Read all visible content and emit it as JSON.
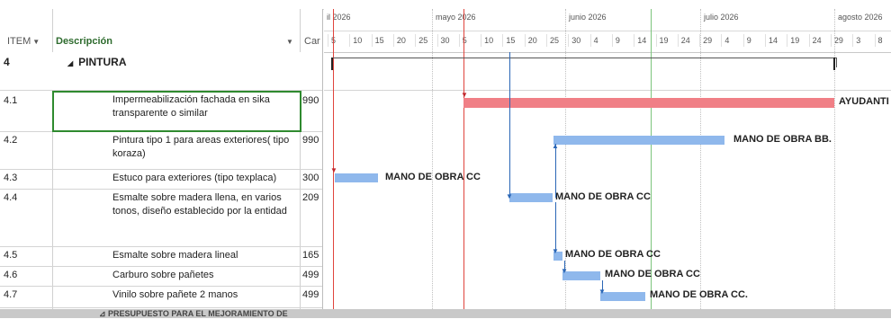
{
  "header": {
    "col_item": "ITEM",
    "col_desc": "Descripción",
    "col_car": "Car"
  },
  "timescale": {
    "months": [
      "il 2026",
      "mayo 2026",
      "junio 2026",
      "julio 2026",
      "agosto 2026"
    ],
    "days": [
      "5",
      "10",
      "15",
      "20",
      "25",
      "30",
      "5",
      "10",
      "15",
      "20",
      "25",
      "30",
      "4",
      "9",
      "14",
      "19",
      "24",
      "29",
      "4",
      "9",
      "14",
      "19",
      "24",
      "29",
      "3",
      "8"
    ]
  },
  "rows": [
    {
      "id": "4",
      "desc": "PINTURA",
      "car": "",
      "summary": true,
      "collapse_glyph": "◢"
    },
    {
      "id": "4.1",
      "desc": "Impermeabilización fachada en sika transparente o similar",
      "car": "990"
    },
    {
      "id": "4.2",
      "desc": "Pintura tipo 1 para areas exteriores( tipo koraza)",
      "car": "990"
    },
    {
      "id": "4.3",
      "desc": "Estuco para exteriores (tipo texplaca)",
      "car": "300"
    },
    {
      "id": "4.4",
      "desc": "Esmalte sobre madera llena, en varios tonos, diseño establecido por la entidad",
      "car": "209"
    },
    {
      "id": "4.5",
      "desc": "Esmalte sobre madera lineal",
      "car": "165"
    },
    {
      "id": "4.6",
      "desc": "Carburo sobre pañetes",
      "car": "499"
    },
    {
      "id": "4.7",
      "desc": "Vinilo sobre pañete 2 manos",
      "car": "499"
    }
  ],
  "bars": [
    {
      "row": "4.1",
      "label": "AYUDANTI",
      "color": "#f07f86"
    },
    {
      "row": "4.2",
      "label": "MANO DE OBRA BB.",
      "color": "#8fb8ec"
    },
    {
      "row": "4.3",
      "label": "MANO DE OBRA CC",
      "color": "#8fb8ec"
    },
    {
      "row": "4.4",
      "label": "MANO DE OBRA CC",
      "color": "#8fb8ec"
    },
    {
      "row": "4.5",
      "label": "MANO DE OBRA CC",
      "color": "#8fb8ec"
    },
    {
      "row": "4.6",
      "label": "MANO DE OBRA CC",
      "color": "#8fb8ec"
    },
    {
      "row": "4.7",
      "label": "MANO DE OBRA CC.",
      "color": "#8fb8ec"
    }
  ],
  "bottom": {
    "text": "⊿ PRESUPUESTO PARA EL MEJORAMIENTO DE"
  },
  "colors": {
    "selection": "#2f8a2f",
    "status_line_red": "#e0443d",
    "status_line_green": "#7cc47c"
  }
}
